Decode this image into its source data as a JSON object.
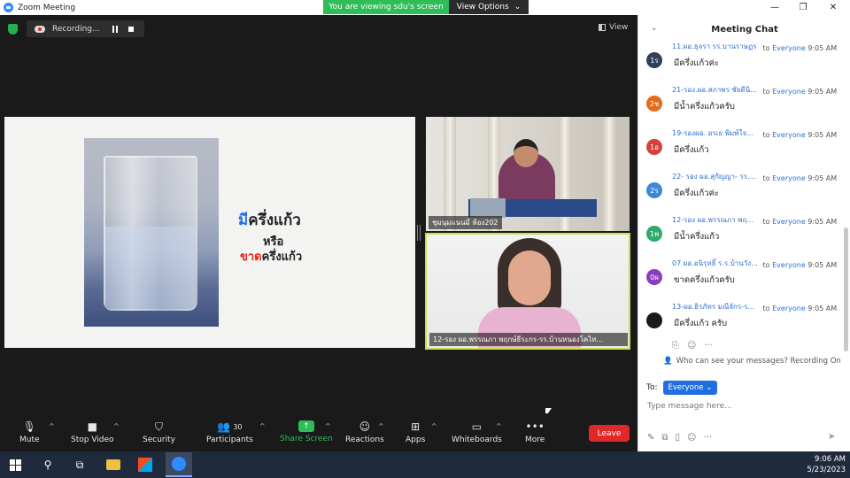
{
  "window": {
    "title": "Zoom Meeting",
    "viewing_banner": "You are viewing sdu's screen",
    "view_options_label": "View Options"
  },
  "meeting_controls": {
    "recording_label": "Recording...",
    "view_label": "View"
  },
  "shared_slide": {
    "line1_highlight": "มี",
    "line1_rest": "ครึ่งแก้ว",
    "line2": "หรือ",
    "line3_highlight": "ขาด",
    "line3_rest": "ครึ่งแก้ว",
    "highlight_colors": {
      "line1": "#1e73e8",
      "line3": "#e8251e"
    }
  },
  "participants": [
    {
      "name": "ชุมนุมแนนมี ห้อง202"
    },
    {
      "name": "12-รอง ผอ.พรรณภา พฤกษ์ธีระกร-รร.บ้านหนองโคไท..."
    }
  ],
  "toolbar": {
    "mute": "Mute",
    "stop_video": "Stop Video",
    "security": "Security",
    "participants_label": "Participants",
    "participants_count": "30",
    "share_screen": "Share Screen",
    "reactions": "Reactions",
    "apps": "Apps",
    "whiteboards": "Whiteboards",
    "more": "More",
    "leave": "Leave"
  },
  "chat": {
    "title": "Meeting Chat",
    "messages": [
      {
        "avatar": "1ร",
        "avatar_color": "#2f4058",
        "sender": "11.ผอ.ธุจรา รร.บานราษฏร",
        "to": "to",
        "recipient": "Everyone",
        "time": "9:05 AM",
        "text": "มีครึ่งแก้วค่ะ"
      },
      {
        "avatar": "2ช",
        "avatar_color": "#e46a1c",
        "sender": "21-รอง.ผอ.สภาพร ชัยดีนิ...",
        "to": "to",
        "recipient": "Everyone",
        "time": "9:05 AM",
        "text": "มีน้ำครึ่งแก้วครับ"
      },
      {
        "avatar": "1อ",
        "avatar_color": "#d6403a",
        "sender": "19-รองผอ. อรเย พิมพ์ใจ...",
        "to": "to",
        "recipient": "Everyone",
        "time": "9:05 AM",
        "text": "มีครึ่งแก้ว"
      },
      {
        "avatar": "2ร",
        "avatar_color": "#3a8ad6",
        "sender": "22- รอง ผอ.สุกัญญา- รร....",
        "to": "to",
        "recipient": "Everyone",
        "time": "9:05 AM",
        "text": "มีครึ่งแก้วค่ะ"
      },
      {
        "avatar": "1พ",
        "avatar_color": "#2eaa6a",
        "sender": "12-รอง ผอ.พรรณภา พฤ...",
        "to": "to",
        "recipient": "Everyone",
        "time": "9:05 AM",
        "text": "มีน้ำครึ่งแก้ว"
      },
      {
        "avatar": "0ผ",
        "avatar_color": "#8c3dbf",
        "sender": "07 ผอ.อนิรุทธิ์ ร.ร.บ้านวัง...",
        "to": "to",
        "recipient": "Everyone",
        "time": "9:05 AM",
        "text": "ขาดครึ่งแก้วครับ"
      },
      {
        "avatar": "",
        "avatar_color": "#1b1b1b",
        "sender": "13-ผอ.ธิรภัทร มณีจักร-ร...",
        "to": "to",
        "recipient": "Everyone",
        "time": "9:05 AM",
        "text": "มีครึ่งแก้ว ครับ"
      }
    ],
    "privacy_note": "Who can see your messages? Recording On",
    "to_label": "To:",
    "to_value": "Everyone",
    "input_placeholder": "Type message here..."
  },
  "taskbar": {
    "time": "9:06 AM",
    "date": "5/23/2023"
  }
}
